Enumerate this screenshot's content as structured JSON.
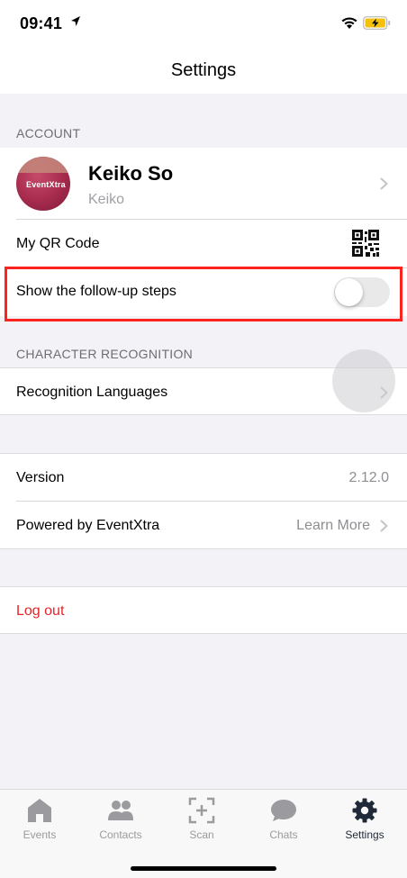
{
  "status_bar": {
    "time": "09:41"
  },
  "nav": {
    "title": "Settings"
  },
  "account": {
    "header": "ACCOUNT",
    "profile": {
      "name": "Keiko So",
      "subtitle": "Keiko",
      "avatar_text": "EventXtra"
    },
    "qr_label": "My QR Code",
    "followup_label": "Show the follow-up steps",
    "followup_enabled": false
  },
  "recognition": {
    "header": "CHARACTER RECOGNITION",
    "languages_label": "Recognition Languages"
  },
  "about": {
    "version_label": "Version",
    "version_value": "2.12.0",
    "powered_label": "Powered by EventXtra",
    "learn_more": "Learn More"
  },
  "logout_label": "Log out",
  "tabs": [
    {
      "label": "Events",
      "icon": "home-icon",
      "active": false
    },
    {
      "label": "Contacts",
      "icon": "contacts-icon",
      "active": false
    },
    {
      "label": "Scan",
      "icon": "scan-icon",
      "active": false
    },
    {
      "label": "Chats",
      "icon": "chat-bubble-icon",
      "active": false
    },
    {
      "label": "Settings",
      "icon": "gear-icon",
      "active": true
    }
  ],
  "colors": {
    "highlight": "#ff2320",
    "logout": "#e5252a",
    "background": "#f2f2f7",
    "tab_inactive": "#9b9b9f",
    "tab_active": "#1f2937"
  }
}
